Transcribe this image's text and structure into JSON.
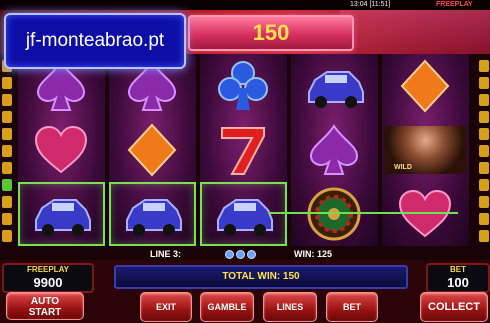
{
  "topbar": {
    "clock": "13:04 [11:51]",
    "mode": "FREEPLAY"
  },
  "header": {
    "win_value": "150"
  },
  "watermark": {
    "text": "jf-monteabrao.pt"
  },
  "side_lines": {
    "left": [
      "",
      "",
      "",
      "",
      "",
      "",
      "",
      "",
      "",
      "1",
      "",
      "",
      ""
    ],
    "right": [
      "",
      "",
      "",
      "",
      "",
      "",
      "",
      "",
      "",
      "",
      "",
      "",
      ""
    ]
  },
  "reels": [
    [
      "spade",
      "heart",
      "car"
    ],
    [
      "spade",
      "diamond",
      "car"
    ],
    [
      "club",
      "seven",
      "car"
    ],
    [
      "car",
      "spade",
      "roulette"
    ],
    [
      "diamond",
      "wild",
      "heart"
    ]
  ],
  "wild_label": "WILD",
  "status": {
    "line_label": "LINE 3:",
    "win_label": "WIN: 125"
  },
  "freeplay": {
    "caption": "FREEPLAY",
    "value": "9900"
  },
  "total_win": "TOTAL WIN: 150",
  "bet": {
    "caption": "BET",
    "value": "100"
  },
  "buttons": {
    "auto_start_1": "AUTO",
    "auto_start_2": "START",
    "exit": "EXIT",
    "gamble": "GAMBLE",
    "lines": "LINES",
    "bet": "BET",
    "collect": "COLLECT"
  },
  "colors": {
    "highlight": "#7be04b",
    "win_yellow": "#ffe14a",
    "button_red": "#c42020"
  }
}
